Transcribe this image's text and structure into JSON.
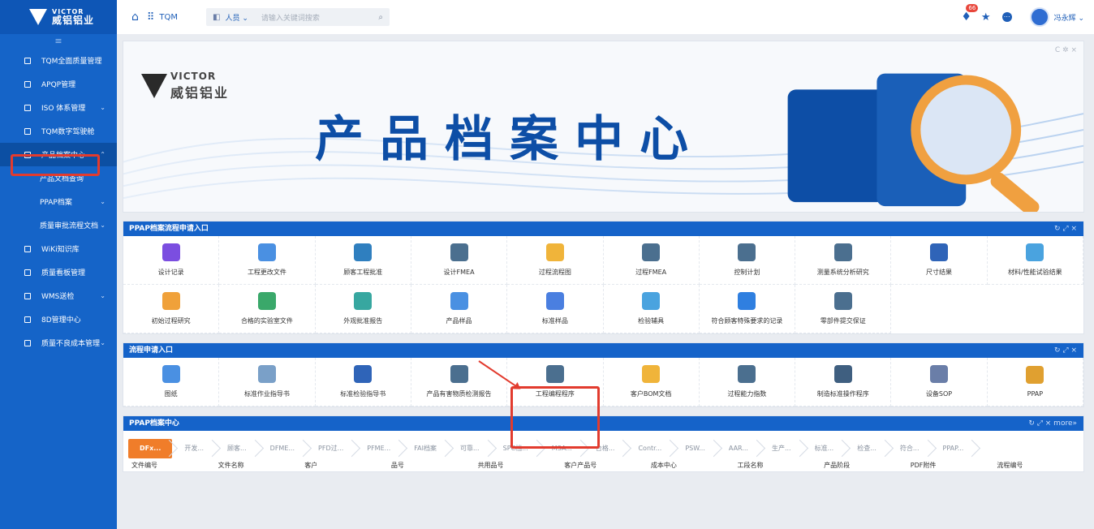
{
  "brand": {
    "en": "VICTOR",
    "cn": "威铝铝业"
  },
  "topbar": {
    "app": "TQM",
    "search_scope": "人员",
    "search_placeholder": "请输入关键词搜索",
    "notif_count": "66",
    "user": "冯永辉"
  },
  "sidebar": {
    "items": [
      {
        "label": "TQM全面质量管理"
      },
      {
        "label": "APQP管理"
      },
      {
        "label": "ISO 体系管理"
      },
      {
        "label": "TQM数字驾驶舱"
      },
      {
        "label": "产品档案中心"
      },
      {
        "label": "产品文档查询"
      },
      {
        "label": "PPAP档案"
      },
      {
        "label": "质量审批流程文档"
      },
      {
        "label": "WiKi知识库"
      },
      {
        "label": "质量看板管理"
      },
      {
        "label": "WMS送检"
      },
      {
        "label": "8D管理中心"
      },
      {
        "label": "质量不良成本管理"
      }
    ]
  },
  "banner": {
    "title": "产品档案中心",
    "controls": "C ✲ ×"
  },
  "ppap_entry": {
    "title": "PPAP档案流程申请入口",
    "controls": "↻ ⤢ ×",
    "items": [
      {
        "label": "设计记录",
        "icon": "doc-list-icon",
        "color": "#7b4ee0"
      },
      {
        "label": "工程更改文件",
        "icon": "circle-doc-icon",
        "color": "#4a90e2"
      },
      {
        "label": "顾客工程批准",
        "icon": "approval-icon",
        "color": "#2f7fbf"
      },
      {
        "label": "设计FMEA",
        "icon": "gear-doc-icon",
        "color": "#4b6f8f"
      },
      {
        "label": "过程流程图",
        "icon": "folder-icon",
        "color": "#f0b43a"
      },
      {
        "label": "过程FMEA",
        "icon": "process-icon",
        "color": "#4b6f8f"
      },
      {
        "label": "控制计划",
        "icon": "plan-icon",
        "color": "#4b6f8f"
      },
      {
        "label": "测量系统分析研究",
        "icon": "measure-icon",
        "color": "#4b6f8f"
      },
      {
        "label": "尺寸结果",
        "icon": "chart-icon",
        "color": "#2f64b8"
      },
      {
        "label": "材料/性能试验结果",
        "icon": "flask-icon",
        "color": "#4aa3df"
      },
      {
        "label": "初始过程研究",
        "icon": "study-icon",
        "color": "#f0a13a"
      },
      {
        "label": "合格的实验室文件",
        "icon": "check-doc-icon",
        "color": "#3aa86a"
      },
      {
        "label": "外观批准报告",
        "icon": "clipboard-icon",
        "color": "#37a7a0"
      },
      {
        "label": "产品样品",
        "icon": "t-doc-icon",
        "color": "#4a90e2"
      },
      {
        "label": "标准样品",
        "icon": "card-icon",
        "color": "#4a7fe0"
      },
      {
        "label": "检验辅具",
        "icon": "list-icon",
        "color": "#4aa3df"
      },
      {
        "label": "符合顾客特殊要求的记录",
        "icon": "record-icon",
        "color": "#2f7fe0"
      },
      {
        "label": "零部件提交保证",
        "icon": "submit-icon",
        "color": "#4b6f8f"
      }
    ]
  },
  "flow_entry": {
    "title": "流程申请入口",
    "controls": "↻ ⤢ ×",
    "items": [
      {
        "label": "图纸",
        "icon": "drawing-icon",
        "color": "#4a90e2"
      },
      {
        "label": "标准作业指导书",
        "icon": "book-icon",
        "color": "#7aa0c8"
      },
      {
        "label": "标准检验指导书",
        "icon": "inspect-doc-icon",
        "color": "#2f64b8"
      },
      {
        "label": "产品有害物质检测报告",
        "icon": "report-icon",
        "color": "#4b6f8f"
      },
      {
        "label": "工程编程程序",
        "icon": "program-icon",
        "color": "#4b6f8f"
      },
      {
        "label": "客户BOM文档",
        "icon": "bom-icon",
        "color": "#f0b43a"
      },
      {
        "label": "过程能力指数",
        "icon": "capability-icon",
        "color": "#4b6f8f"
      },
      {
        "label": "制造标准操作程序",
        "icon": "sop-make-icon",
        "color": "#3f5f80"
      },
      {
        "label": "设备SOP",
        "icon": "device-icon",
        "color": "#6a7ea8"
      },
      {
        "label": "PPAP",
        "icon": "ppap-icon",
        "color": "#e0a030"
      }
    ]
  },
  "archive": {
    "title": "PPAP档案中心",
    "controls": "↻ ⤢ × more»",
    "tabs": [
      "DFx...",
      "开发...",
      "顾客...",
      "DFME...",
      "PFD过...",
      "PFME...",
      "FAI档案",
      "可靠...",
      "SPC档...",
      "MSA...",
      "合格...",
      "Contr...",
      "PSW...",
      "AAR...",
      "生产...",
      "标准...",
      "检查...",
      "符合...",
      "PPAP..."
    ],
    "columns": [
      "文件编号",
      "文件名称",
      "客户",
      "品号",
      "共用品号",
      "客户产品号",
      "成本中心",
      "工段名称",
      "产品阶段",
      "PDF附件",
      "流程编号"
    ]
  }
}
